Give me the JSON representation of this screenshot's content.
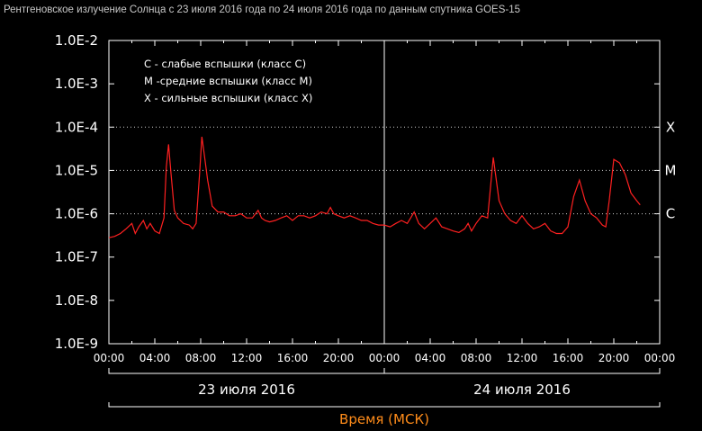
{
  "colors": {
    "background": "#000000",
    "series": "#ff2020",
    "text": "#ffffff",
    "axis_title": "#ff8c1a"
  },
  "chart_data": {
    "type": "line",
    "title": "Рентгеновское излучение Солнца с 23 июля 2016 года по 24 июля 2016 года по данным спутника GOES-15",
    "xlabel": "Время (МСК)",
    "ylabel": "",
    "y_scale": "log",
    "ylim": [
      1e-09,
      0.01
    ],
    "y_ticks": [
      "1.0E-9",
      "1.0E-8",
      "1.0E-7",
      "1.0E-6",
      "1.0E-5",
      "1.0E-4",
      "1.0E-3",
      "1.0E-2"
    ],
    "x_ticks": [
      "00:00",
      "04:00",
      "08:00",
      "12:00",
      "16:00",
      "20:00",
      "00:00",
      "04:00",
      "08:00",
      "12:00",
      "16:00",
      "20:00",
      "00:00"
    ],
    "xlim_hours": [
      0,
      48
    ],
    "days": [
      "23 июля 2016",
      "24 июля 2016"
    ],
    "class_levels": [
      {
        "label": "C",
        "value": 1e-06
      },
      {
        "label": "M",
        "value": 1e-05
      },
      {
        "label": "X",
        "value": 0.0001
      }
    ],
    "legend": [
      "C - слабые вспышки (класс C)",
      "M -средние вспышки (класс M)",
      "X - сильные вспышки (класс X)"
    ],
    "legend_position": "top-left",
    "grid": "dotted lines at class levels",
    "series": [
      {
        "x": [
          0,
          0.5,
          1,
          1.5,
          2,
          2.3,
          2.6,
          3,
          3.3,
          3.6,
          4,
          4.4,
          4.8,
          5,
          5.2,
          5.4,
          5.7,
          6,
          6.5,
          7,
          7.3,
          7.6,
          7.9,
          8.1,
          8.3,
          8.6,
          9,
          9.5,
          10,
          10.5,
          11,
          11.5,
          12,
          12.5,
          13,
          13.3,
          13.6,
          14,
          14.5,
          15,
          15.5,
          16,
          16.5,
          17,
          17.5,
          18,
          18.5,
          19,
          19.3,
          19.6,
          20,
          20.5,
          21,
          21.5,
          22,
          22.5,
          23,
          23.5,
          24,
          24.5,
          25,
          25.5,
          26,
          26.3,
          26.6,
          27,
          27.5,
          28,
          28.5,
          29,
          29.5,
          30,
          30.5,
          31,
          31.3,
          31.6,
          32,
          32.5,
          33,
          33.5,
          34,
          34.5,
          35,
          35.5,
          36,
          36.5,
          37,
          37.5,
          38,
          38.5,
          39,
          39.5,
          40,
          40.5,
          41,
          41.5,
          42,
          42.5,
          43,
          43.3,
          43.6,
          44,
          44.5,
          45,
          45.5,
          46,
          46.3
        ],
        "y": [
          2.8e-07,
          3e-07,
          3.5e-07,
          4.5e-07,
          6e-07,
          3.5e-07,
          5e-07,
          7e-07,
          4.5e-07,
          6e-07,
          4e-07,
          3.5e-07,
          8e-07,
          1.2e-05,
          4e-05,
          9e-06,
          1.2e-06,
          8e-07,
          6e-07,
          5.5e-07,
          4.5e-07,
          6e-07,
          8e-06,
          6e-05,
          2.5e-05,
          6e-06,
          1.5e-06,
          1.1e-06,
          1.1e-06,
          9e-07,
          9e-07,
          1e-06,
          8e-07,
          8e-07,
          1.2e-06,
          8e-07,
          7e-07,
          6.5e-07,
          7e-07,
          8e-07,
          9e-07,
          7e-07,
          9e-07,
          9e-07,
          8e-07,
          9e-07,
          1.1e-06,
          1e-06,
          1.4e-06,
          1e-06,
          9e-07,
          8e-07,
          9e-07,
          8e-07,
          7e-07,
          7e-07,
          6e-07,
          5.5e-07,
          5.5e-07,
          5e-07,
          6e-07,
          7e-07,
          6e-07,
          8e-07,
          1.1e-06,
          6e-07,
          4.5e-07,
          6e-07,
          8e-07,
          5e-07,
          4.5e-07,
          4e-07,
          3.7e-07,
          4.5e-07,
          6e-07,
          4e-07,
          6e-07,
          9e-07,
          8e-07,
          2e-05,
          2e-06,
          1e-06,
          7e-07,
          6e-07,
          9e-07,
          6e-07,
          4.5e-07,
          5e-07,
          6e-07,
          4e-07,
          3.5e-07,
          3.5e-07,
          5e-07,
          2.5e-06,
          6e-06,
          2e-06,
          1e-06,
          8e-07,
          5.5e-07,
          5e-07,
          2e-06,
          1.8e-05,
          1.5e-05,
          8e-06,
          3e-06,
          2e-06,
          1.6e-06
        ]
      }
    ]
  }
}
